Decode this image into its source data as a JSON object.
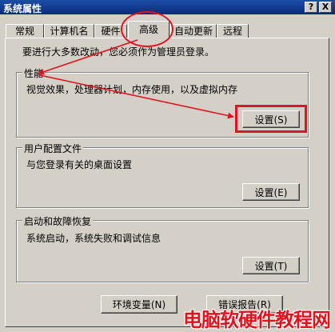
{
  "window": {
    "title": "系统属性",
    "help_label": "?",
    "close_label": "X"
  },
  "tabs": [
    {
      "label": "常规"
    },
    {
      "label": "计算机名"
    },
    {
      "label": "硬件"
    },
    {
      "label": "高级"
    },
    {
      "label": "自动更新"
    },
    {
      "label": "远程"
    }
  ],
  "active_tab": "高级",
  "notice": "要进行大多数改动，您必须作为管理员登录。",
  "performance": {
    "title": "性能",
    "description": "视觉效果，处理器计划，内存使用，以及虚拟内存",
    "button_label": "设置(S)"
  },
  "user_profiles": {
    "title": "用户配置文件",
    "description": "与您登录有关的桌面设置",
    "button_label": "设置(E)"
  },
  "startup_recovery": {
    "title": "启动和故障恢复",
    "description": "系统启动，系统失败和调试信息",
    "button_label": "设置(T)"
  },
  "bottom_buttons": {
    "env_vars_label": "环境变量(N)",
    "error_report_label": "错误报告(R)"
  },
  "annotation_color": "#e0141e",
  "watermark": "电脑软硬件教程网"
}
